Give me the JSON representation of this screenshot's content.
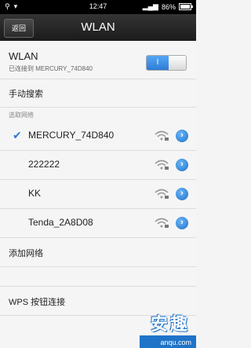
{
  "status_bar": {
    "time": "12:47",
    "battery_text": "86%"
  },
  "header": {
    "back_label": "返回",
    "title": "WLAN"
  },
  "wlan_toggle": {
    "label": "WLAN",
    "status": "已连接到 MERCURY_74D840",
    "switch_text": "I"
  },
  "manual_search": {
    "label": "手动搜索"
  },
  "networks_section": {
    "label": "选取网络"
  },
  "networks": [
    {
      "name": "MERCURY_74D840",
      "connected": true
    },
    {
      "name": "222222",
      "connected": false
    },
    {
      "name": "KK",
      "connected": false
    },
    {
      "name": "Tenda_2A8D08",
      "connected": false
    }
  ],
  "add_network": {
    "label": "添加网络"
  },
  "wps": {
    "label": "WPS 按钮连接"
  },
  "watermark": {
    "big": "安趣",
    "url": "anqu.com"
  },
  "colors": {
    "accent": "#2a7ad6",
    "titlebar": "#222222",
    "background": "#f5f5f5"
  },
  "icons": [
    "usb-icon",
    "signal-icon",
    "wifi-lock-icon",
    "detail-arrow-icon",
    "check-icon"
  ]
}
